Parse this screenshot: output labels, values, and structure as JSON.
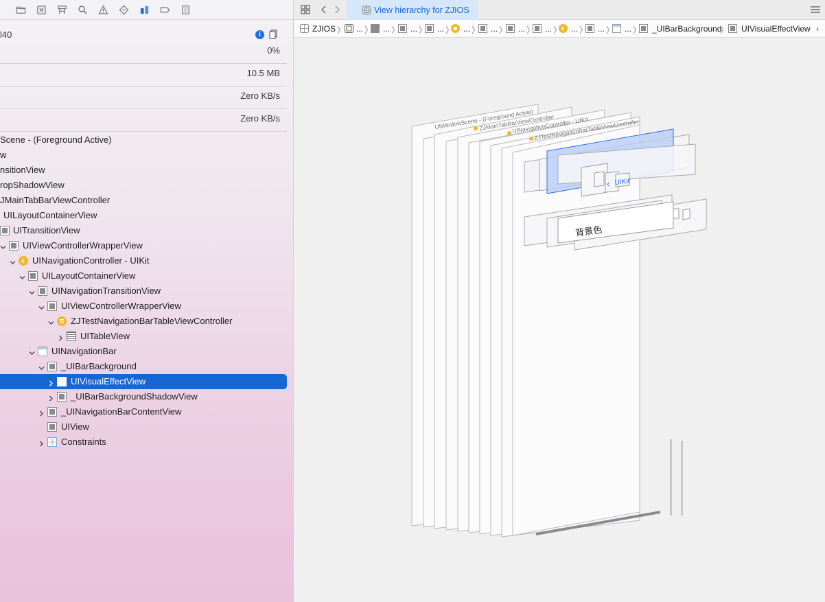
{
  "navigator": {
    "debug": {
      "cpu_label": "l40",
      "cpu_value": "0%",
      "memory_value": "10.5 MB",
      "disk_value": "Zero KB/s",
      "network_value": "Zero KB/s"
    },
    "tree": [
      {
        "label": "Scene - (Foreground Active)"
      },
      {
        "label": "w"
      },
      {
        "label": "nsitionView"
      },
      {
        "label": "ropShadowView"
      },
      {
        "label": "JMainTabBarViewController"
      },
      {
        "label": "UILayoutContainerView"
      },
      {
        "label": "UITransitionView"
      },
      {
        "label": "UIViewControllerWrapperView"
      },
      {
        "label": "UINavigationController - UIKit"
      },
      {
        "label": "UILayoutContainerView"
      },
      {
        "label": "UINavigationTransitionView"
      },
      {
        "label": "UIViewControllerWrapperView"
      },
      {
        "label": "ZJTestNavigationBarTableViewController"
      },
      {
        "label": "UITableView"
      },
      {
        "label": "UINavigationBar"
      },
      {
        "label": "_UIBarBackground"
      },
      {
        "label": "UIVisualEffectView"
      },
      {
        "label": "_UIBarBackgroundShadowView"
      },
      {
        "label": "_UINavigationBarContentView"
      },
      {
        "label": "UIView"
      },
      {
        "label": "Constraints"
      }
    ]
  },
  "editor": {
    "tab_title": "View hierarchy for ZJIOS",
    "jumpbar": {
      "root": "ZJIOS",
      "ellipsis": "...",
      "bar_background": "_UIBarBackground",
      "current": "UIVisualEffectView"
    },
    "canvas": {
      "layer_labels": [
        "UIWindowScene - (Foreground Active)",
        "ZJMainTabBarViewController",
        "UINavigationController - UIKit",
        "ZJTestNavigationBarTableViewController"
      ],
      "nav_back_text": "UIKit",
      "content_text": "背景色"
    }
  },
  "colors": {
    "selection": "#1666d4",
    "accent": "#1f6fe0",
    "controller_badge": "#f2b52b"
  }
}
